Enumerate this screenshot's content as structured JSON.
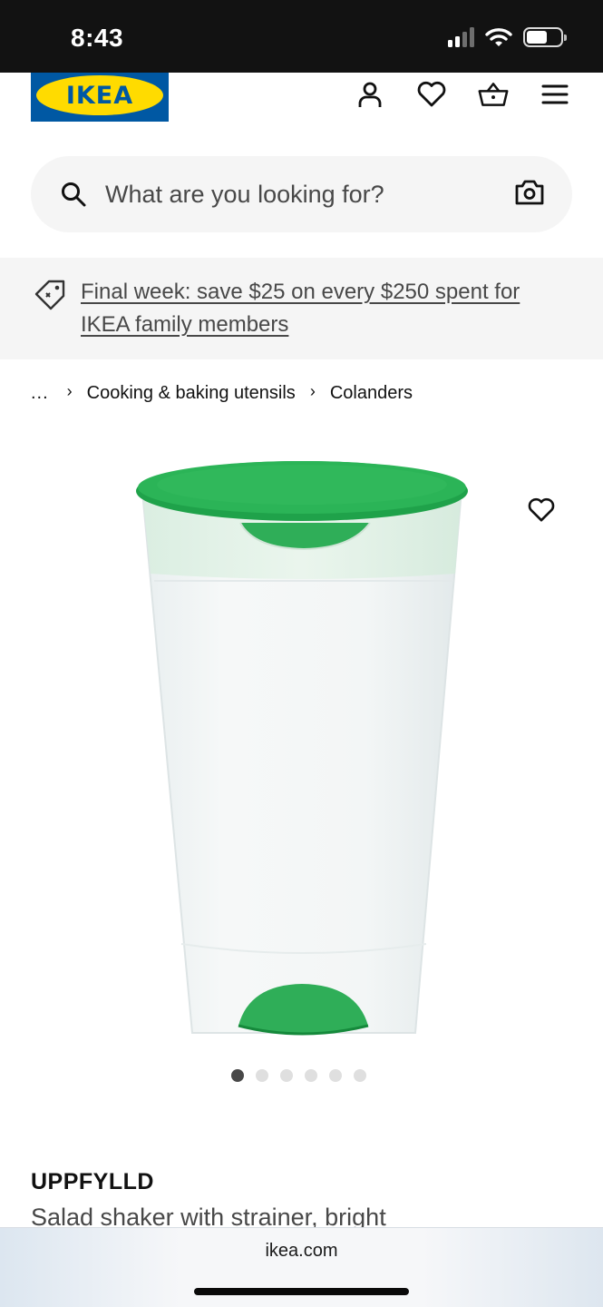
{
  "status_bar": {
    "time": "8:43",
    "icons": [
      "cellular-signal-icon",
      "wifi-icon",
      "battery-icon"
    ]
  },
  "header": {
    "logo_text": "IKEA",
    "icons": [
      "profile-icon",
      "heart-icon",
      "basket-icon",
      "menu-icon"
    ]
  },
  "search": {
    "placeholder": "What are you looking for?",
    "icon": "search-icon",
    "camera_icon": "camera-icon"
  },
  "promo": {
    "text": "Final week: save $25 on every $250 spent for IKEA family members",
    "icon": "tag-icon"
  },
  "breadcrumb": {
    "ellipsis": "...",
    "items": [
      "Cooking & baking utensils",
      "Colanders"
    ]
  },
  "gallery": {
    "image_count": 6,
    "active_index": 0
  },
  "product": {
    "name": "UPPFYLLD",
    "description": "Salad shaker with strainer, bright"
  },
  "browser": {
    "url": "ikea.com"
  },
  "colors": {
    "ikea_blue": "#0058a3",
    "ikea_yellow": "#ffdb00",
    "lid_green": "#22a84e"
  }
}
